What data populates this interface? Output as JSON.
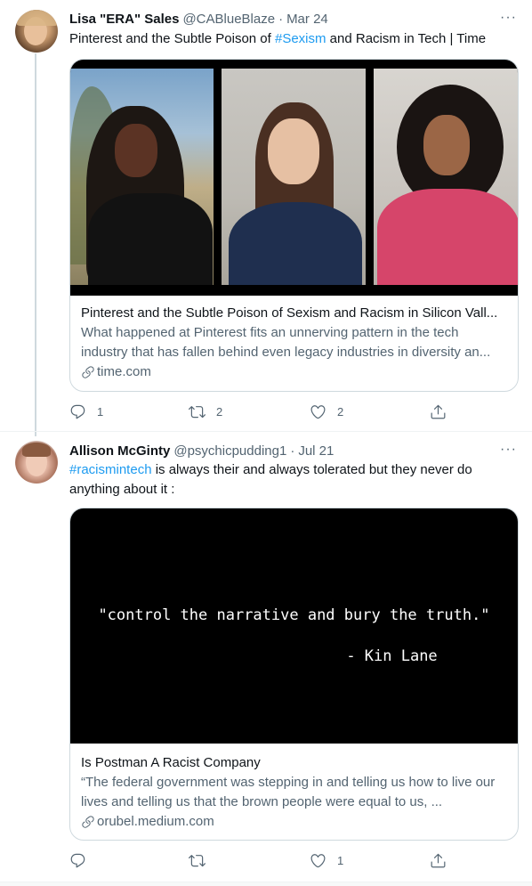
{
  "tweets": [
    {
      "author_name": "Lisa \"ERA\" Sales",
      "handle": "@CABlueBlaze",
      "separator": "·",
      "date": "Mar 24",
      "more": "···",
      "text_before": "Pinterest and the Subtle Poison of ",
      "hashtag": "#Sexism",
      "text_after": " and Racism in Tech | Time",
      "card": {
        "title": "Pinterest and the Subtle Poison of Sexism and Racism in Silicon Vall...",
        "description": "What happened at Pinterest fits an unnerving pattern in the tech industry that has fallen behind even legacy industries in diversity an...",
        "domain": "time.com"
      },
      "actions": {
        "reply_count": "1",
        "retweet_count": "2",
        "like_count": "2",
        "share_count": ""
      }
    },
    {
      "author_name": "Allison McGinty",
      "handle": "@psychicpudding1",
      "separator": "·",
      "date": "Jul 21",
      "more": "···",
      "text_before": "",
      "hashtag": "#racismintech",
      "text_after": " is always their and always tolerated but they never do anything about it :",
      "card": {
        "quote_line1": "\"control the narrative and bury the truth.\"",
        "quote_line2": "- Kin Lane",
        "title": "Is Postman A Racist Company",
        "description": "“The federal government was stepping in and telling us how to live our lives and telling us that the brown people were equal to us, ...",
        "domain": "orubel.medium.com"
      },
      "actions": {
        "reply_count": "",
        "retweet_count": "",
        "like_count": "1",
        "share_count": ""
      }
    }
  ],
  "colors": {
    "text_primary": "#0f1419",
    "text_secondary": "#536471",
    "link": "#1d9bf0",
    "border": "#cfd9de"
  },
  "icons": {
    "reply": "reply-icon",
    "retweet": "retweet-icon",
    "like": "heart-icon",
    "share": "share-icon",
    "link": "link-icon",
    "more": "more-icon"
  }
}
